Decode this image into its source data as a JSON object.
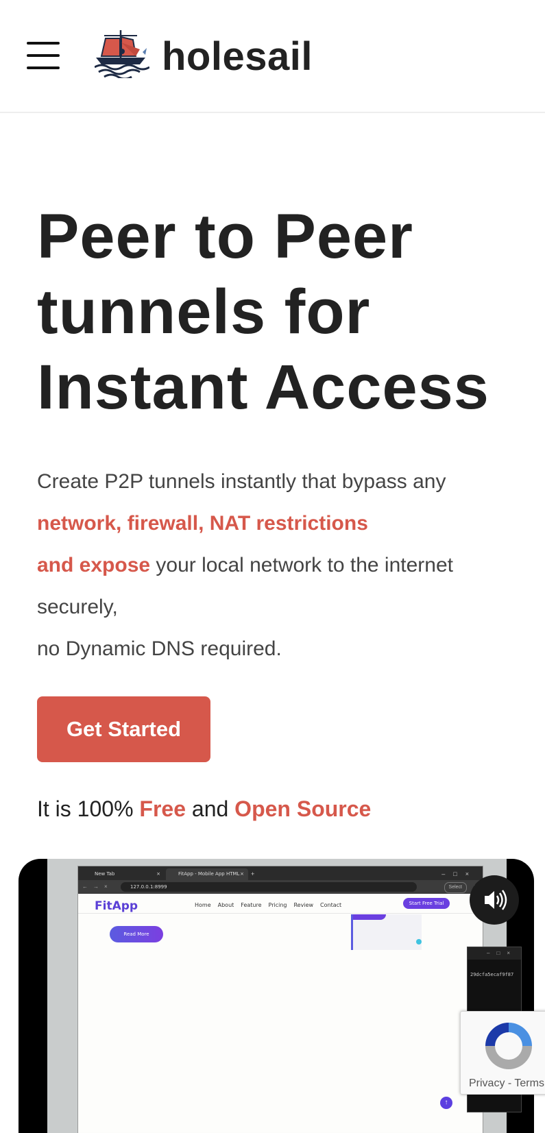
{
  "header": {
    "brand": "holesail",
    "menu_icon": "hamburger-menu-icon",
    "logo_icon": "sailboat-logo-icon"
  },
  "hero": {
    "title": "Peer to Peer tunnels for Instant Access",
    "text_part1": "Create P2P tunnels instantly that bypass any",
    "highlight1": "network, firewall, NAT restrictions",
    "highlight2": "and expose",
    "text_part2": " your local network to the internet securely,",
    "text_part3": "no Dynamic DNS required.",
    "cta_label": "Get Started",
    "free_prefix": "It is 100% ",
    "free_word": "Free",
    "free_mid": " and ",
    "open_source_word": "Open Source"
  },
  "video": {
    "browser": {
      "tab1": "New Tab",
      "tab2": "FitApp - Mobile App HTML Ten",
      "url": "127.0.0.1:8999",
      "addr_pill": "Select",
      "site_logo": "FitApp",
      "nav": [
        "Home",
        "About",
        "Feature",
        "Pricing",
        "Review",
        "Contact"
      ],
      "trial_button": "Start Free Trial",
      "read_more": "Read More"
    },
    "terminal_text": "29dcfa5ecaf9f87",
    "mute_icon": "speaker-volume-icon"
  },
  "recaptcha": {
    "privacy": "Privacy",
    "separator": " - ",
    "terms": "Terms"
  },
  "colors": {
    "accent": "#d6584b",
    "text_dark": "#222222",
    "text_body": "#444444"
  }
}
